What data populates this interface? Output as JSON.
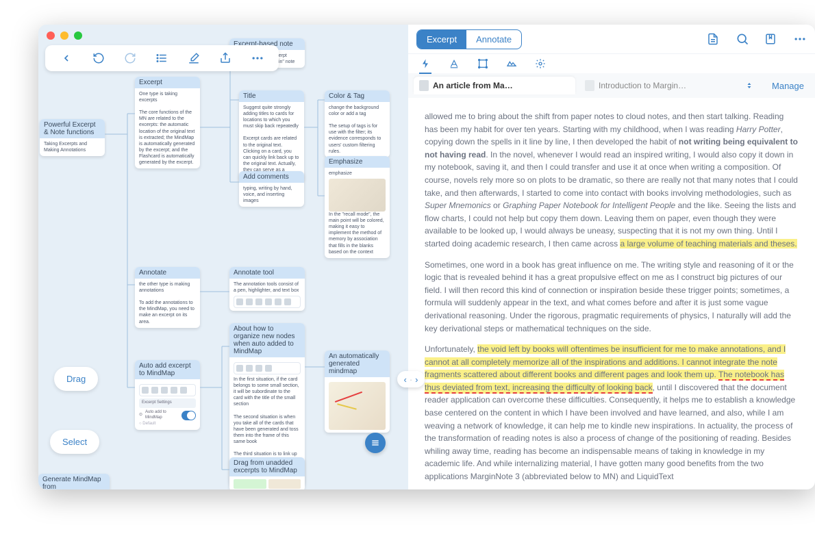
{
  "window": {
    "seg_excerpt": "Excerpt",
    "seg_annotate": "Annotate",
    "manage": "Manage",
    "doc_tab1": "An article from Ma…",
    "doc_tab2": "Introduction to Margin…"
  },
  "pills": {
    "drag": "Drag",
    "select": "Select"
  },
  "cards": {
    "excerpt_based_note": {
      "title": "Excerpt-based note",
      "body": "How to create an excerpt based note…a \"margin\" note"
    },
    "powerful": {
      "title": "Powerful Excerpt & Note functions",
      "body": "Taking Excerpts and Making Annotations"
    },
    "excerpt": {
      "title": "Excerpt",
      "body": "One type is taking excerpts\n\nThe core functions of the MN are related to the excerpts: the automatic location of the original text is extracted; the MindMap is automatically generated by the excerpt; and the Flashcard is automatically generated by the excerpt."
    },
    "title_card": {
      "title": "Title",
      "body": "Suggest quite strongly adding titles to cards for locations to which you must skip back repeatedly\n\nExcerpt cards are related to the original text. Clicking on a card, you can quickly link back up to the original text. Actually, they can serve as a bookmark"
    },
    "color_tag": {
      "title": "Color & Tag",
      "body": "change the background color or add a tag\n\nThe setup of tags is for use with the filter; its evidence corresponds to users' custom filtering rules."
    },
    "emphasize": {
      "title": "Emphasize",
      "body": "emphasize",
      "body2": "In the \"recall mode\", the main point will be colored, making it easy to implement the method of memory by association that fills in the blanks based on the context"
    },
    "add_comments": {
      "title": "Add comments",
      "body": "typing, writing by hand, voice, and inserting images"
    },
    "annotate": {
      "title": "Annotate",
      "body": "the other type is making annotations\n\nTo add the annotations to the MindMap, you need to make an excerpt on its area."
    },
    "annotate_tool": {
      "title": "Annotate tool",
      "body": "The annotation tools consist of a pen, highlighter, and text box"
    },
    "about_organize": {
      "title": "About how to organize new nodes when auto added to MindMap",
      "body": "In the first situation, if the card belongs to some small section, it will be subordinate to the card with the title of the small section\n\nThe second situation is when you take all of the cards that have been generated and toss them into the frame of this same book\n\nThe third situation is to link up the card to the end of the selected card. If it is not selected, it will be listed seperately"
    },
    "auto_add": {
      "title": "Auto add excerpt to MindMap",
      "body": "Auto add to MindMap"
    },
    "auto_gen": {
      "title": "An automatically generated mindmap"
    },
    "drag_unadded": {
      "title": "Drag from unadded excerpts to MindMap"
    },
    "gen_mindmap": {
      "title": "Generate MindMap from"
    }
  },
  "article": {
    "p1_a": "allowed me to bring about the shift from paper notes to cloud notes, and then start talking. Reading has been my habit for over ten years. Starting with my childhood, when I was reading ",
    "p1_hp": "Harry Potter",
    "p1_b": ", copying down the spells in it line by line, I then developed the habit of ",
    "p1_bold": "not writing being equivalent to not having read",
    "p1_c": ". In the novel, whenever I would read an inspired writing, I would also copy it down in my notebook, saving it, and then I could transfer and use it at once when writing a composition. Of course, novels rely more so on plots to be dramatic, so there are really not that many notes that I could take, and then afterwards, I started to come into contact with books involving methodologies, such as ",
    "p1_em1": "Super Mnemonics",
    "p1_or": " or ",
    "p1_em2": "Graphing Paper Notebook for Intelligent People",
    "p1_d": " and the like. Seeing the lists and flow charts, I could not help but copy them down. Leaving them on paper, even though they were available to be looked up, I would always be uneasy, suspecting that it is not my own thing. Until I started doing academic research, I then came across ",
    "p1_hl": "a large volume of teaching materials and theses.",
    "p2_a": "Sometimes, one word in a book has great influence on me. The writing style and reasoning of it or the logic that is revealed behind it has a great propulsive effect on me as I construct big pictures of our field. I will then record this kind of connection or inspiration beside these trigger points; sometimes, a formula will suddenly appear in the text, and what comes before and after it is just some vague derivational reasoning. Under the rigorous, pragmatic requirements of physics, I naturally will add the key derivational steps or mathematical techniques on the side.",
    "p3_a": "Unfortunately, ",
    "p3_hl1": "the void left by books will oftentimes be insufficient for me to make annotations, and I cannot at all completely memorize all of the inspirations and additions. I cannot integrate the note fragments scattered about different books and different pages and look them up. ",
    "p3_hl2": "The notebook has thus deviated from text, increasing the difficulty of looking back",
    "p3_b": ", until I discovered that the document reader application can overcome these difficulties. Consequently, it helps me to establish a knowledge base centered on the content in which I have been involved and have learned, and also, while I am weaving a network of knowledge, it can help me to kindle new inspirations. In actuality, the process of the transformation of reading notes is also a process of change of the positioning of reading. Besides whiling away time, reading has become an indispensable means of taking in knowledge in my academic life. And while internalizing material, I have gotten many good benefits from the two applications MarginNote 3 (abbreviated below to MN) and LiquidText"
  }
}
